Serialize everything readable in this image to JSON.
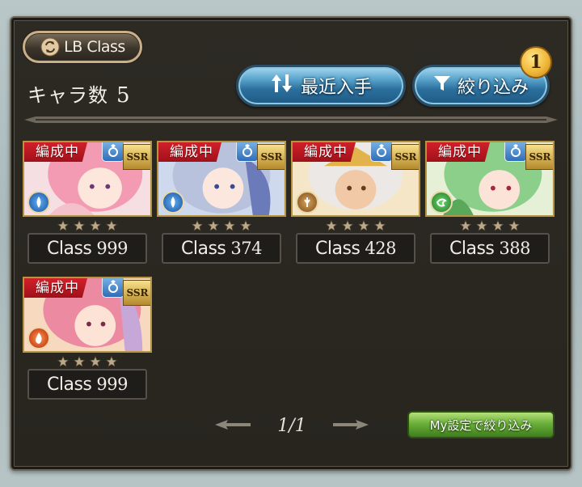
{
  "header": {
    "lb_button_label": "LB Class",
    "count_label": "キャラ数",
    "count_value": "5"
  },
  "buttons": {
    "sort_label": "最近入手",
    "filter_label": "絞り込み",
    "filter_badge": "1",
    "my_filter_label": "My設定で絞り込み"
  },
  "tag_label": "編成中",
  "rarity_label": "SSR",
  "class_prefix": "Class",
  "stars_per_card": 4,
  "cards": [
    {
      "class_value": "999",
      "element": "water"
    },
    {
      "class_value": "374",
      "element": "water"
    },
    {
      "class_value": "428",
      "element": "earth"
    },
    {
      "class_value": "388",
      "element": "wind"
    },
    {
      "class_value": "999",
      "element": "fire"
    }
  ],
  "pagination": {
    "label": "1/1"
  },
  "colors": {
    "panel": "#2b2822",
    "tag_red": "#c11a24",
    "button_blue": "#2b6f9c",
    "button_green": "#6ab03a",
    "badge_gold": "#f0b83a"
  }
}
